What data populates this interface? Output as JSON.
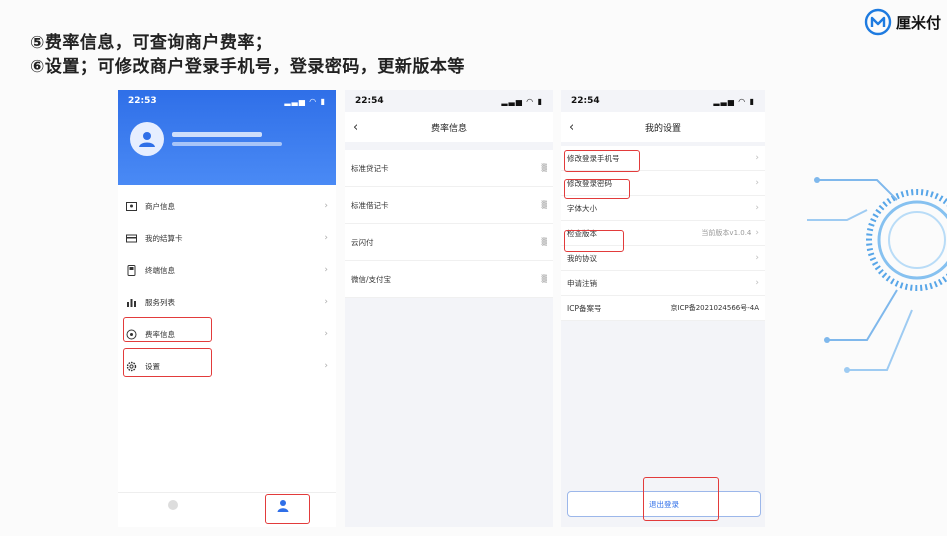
{
  "slide": {
    "line1": "⑤费率信息，可查询商户费率；",
    "line2": "⑥设置；可修改商户登录手机号，登录密码，更新版本等",
    "brand": "厘米付"
  },
  "phone1": {
    "time": "22:53",
    "menu": [
      {
        "label": "商户信息",
        "icon": "id-card-icon"
      },
      {
        "label": "我的结算卡",
        "icon": "bank-card-icon"
      },
      {
        "label": "终端信息",
        "icon": "terminal-icon"
      },
      {
        "label": "服务列表",
        "icon": "list-icon"
      },
      {
        "label": "费率信息",
        "icon": "rate-icon"
      },
      {
        "label": "设置",
        "icon": "gear-icon"
      }
    ],
    "chevron": "›"
  },
  "phone2": {
    "time": "22:54",
    "back": "‹",
    "title": "费率信息",
    "rows": [
      {
        "label": "标准贷记卡"
      },
      {
        "label": "标准借记卡"
      },
      {
        "label": "云闪付"
      },
      {
        "label": "微信/支付宝"
      }
    ]
  },
  "phone3": {
    "time": "22:54",
    "back": "‹",
    "title": "我的设置",
    "rows": [
      {
        "label": "修改登录手机号",
        "value": ""
      },
      {
        "label": "修改登录密码",
        "value": ""
      },
      {
        "label": "字体大小",
        "value": ""
      },
      {
        "label": "检查版本",
        "value": "当前版本v1.0.4"
      },
      {
        "label": "我的协议",
        "value": ""
      },
      {
        "label": "申请注销",
        "value": ""
      },
      {
        "label": "ICP备案号",
        "value": "京ICP备2021024566号-4A"
      }
    ],
    "logout": "退出登录"
  },
  "colors": {
    "primary": "#2f6fe8",
    "highlight": "#e23b3b"
  }
}
